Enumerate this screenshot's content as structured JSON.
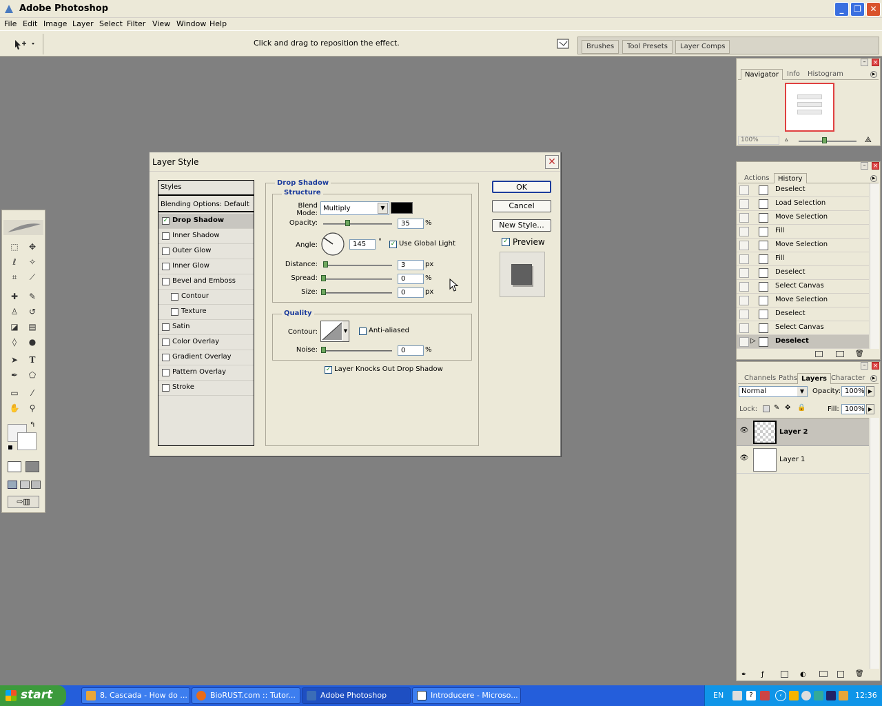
{
  "app": {
    "title": "Adobe Photoshop"
  },
  "menu": [
    "File",
    "Edit",
    "Image",
    "Layer",
    "Select",
    "Filter",
    "View",
    "Window",
    "Help"
  ],
  "options_bar": {
    "message": "Click and drag to reposition the effect.",
    "wells": [
      "Brushes",
      "Tool Presets",
      "Layer Comps"
    ]
  },
  "navigator": {
    "tabs": [
      "Navigator",
      "Info",
      "Histogram"
    ],
    "zoom": "100%"
  },
  "history": {
    "tabs": [
      "Actions",
      "History"
    ],
    "items": [
      "Deselect",
      "Load Selection",
      "Move Selection",
      "Fill",
      "Move Selection",
      "Fill",
      "Deselect",
      "Select Canvas",
      "Move Selection",
      "Deselect",
      "Select Canvas",
      "Deselect"
    ],
    "current_index": 11
  },
  "layers": {
    "tabs": [
      "Channels",
      "Paths",
      "Layers",
      "Character"
    ],
    "blend_mode": "Normal",
    "opacity_label": "Opacity:",
    "opacity": "100%",
    "lock_label": "Lock:",
    "fill_label": "Fill:",
    "fill": "100%",
    "items": [
      "Layer 2",
      "Layer 1"
    ],
    "selected": "Layer 2"
  },
  "dialog": {
    "title": "Layer Style",
    "styles_header": "Styles",
    "blending": "Blending Options: Default",
    "style_items": [
      {
        "label": "Drop Shadow",
        "checked": true,
        "selected": true
      },
      {
        "label": "Inner Shadow",
        "checked": false
      },
      {
        "label": "Outer Glow",
        "checked": false
      },
      {
        "label": "Inner Glow",
        "checked": false
      },
      {
        "label": "Bevel and Emboss",
        "checked": false
      },
      {
        "label": "Contour",
        "checked": false,
        "indent": true
      },
      {
        "label": "Texture",
        "checked": false,
        "indent": true
      },
      {
        "label": "Satin",
        "checked": false
      },
      {
        "label": "Color Overlay",
        "checked": false
      },
      {
        "label": "Gradient Overlay",
        "checked": false
      },
      {
        "label": "Pattern Overlay",
        "checked": false
      },
      {
        "label": "Stroke",
        "checked": false
      }
    ],
    "section_title": "Drop Shadow",
    "structure_title": "Structure",
    "blend_mode_label": "Blend Mode:",
    "blend_mode": "Multiply",
    "shadow_color": "#000000",
    "opacity_label": "Opacity:",
    "opacity": "35",
    "angle_label": "Angle:",
    "angle": "145",
    "global_light_label": "Use Global Light",
    "distance_label": "Distance:",
    "distance": "3",
    "spread_label": "Spread:",
    "spread": "0",
    "size_label": "Size:",
    "size": "0",
    "quality_title": "Quality",
    "contour_label": "Contour:",
    "anti_aliased_label": "Anti-aliased",
    "noise_label": "Noise:",
    "noise": "0",
    "knockout_label": "Layer Knocks Out Drop Shadow",
    "units": {
      "pct": "%",
      "px": "px",
      "deg": "°"
    },
    "ok": "OK",
    "cancel": "Cancel",
    "new_style": "New Style...",
    "preview_label": "Preview"
  },
  "taskbar": {
    "start": "start",
    "tasks": [
      "8. Cascada - How do ...",
      "BioRUST.com :: Tutor...",
      "Adobe Photoshop",
      "Introducere - Microso..."
    ],
    "active_index": 2,
    "lang": "EN",
    "clock": "12:36"
  }
}
